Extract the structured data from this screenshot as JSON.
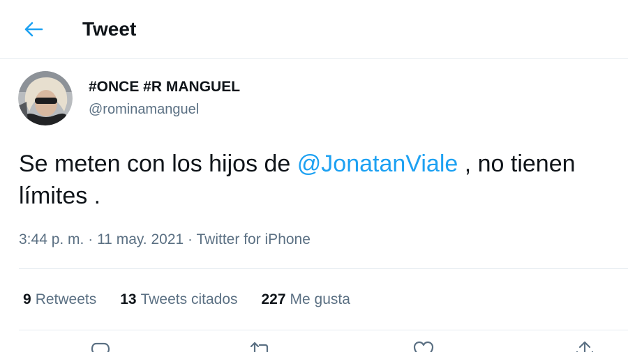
{
  "header": {
    "title": "Tweet",
    "back_icon": "arrow-left-icon",
    "accent_color": "#1da1f2"
  },
  "author": {
    "display_name": "#ONCE #R MANGUEL",
    "handle": "@rominamanguel",
    "avatar_icon": "user-avatar"
  },
  "tweet": {
    "text_before": "Se meten con los hijos de ",
    "mention": "@JonatanViale",
    "text_after": " , no tienen límites ."
  },
  "meta": {
    "time": "3:44 p. m.",
    "separator": " · ",
    "date": "11 may. 2021",
    "source": "Twitter for iPhone"
  },
  "stats": {
    "retweets_count": "9",
    "retweets_label": "Retweets",
    "quotes_count": "13",
    "quotes_label": "Tweets citados",
    "likes_count": "227",
    "likes_label": "Me gusta"
  },
  "actions": {
    "icons": [
      "reply-icon",
      "retweet-icon",
      "like-icon",
      "share-icon"
    ]
  },
  "colors": {
    "text_primary": "#0f1419",
    "text_secondary": "#5b7083",
    "divider": "#e6ecf0",
    "link": "#1da1f2"
  }
}
